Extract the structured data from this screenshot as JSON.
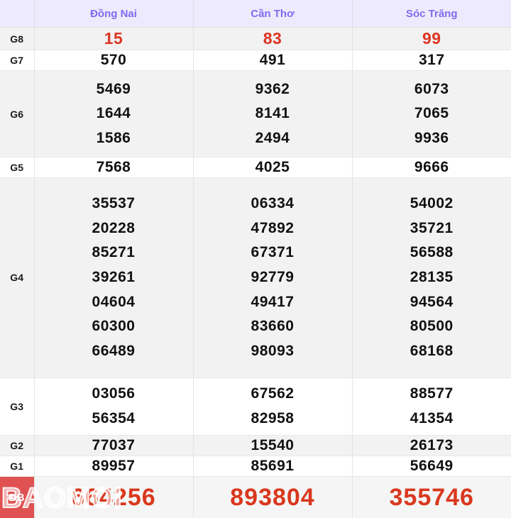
{
  "table": {
    "corner_label": "",
    "columns": [
      "Đồng Nai",
      "Cần Thơ",
      "Sóc Trăng"
    ],
    "colors": {
      "header_bg": "#eeeafd",
      "header_text": "#7d6cf0",
      "row_gray_bg": "#f2f2f2",
      "row_white_bg": "#ffffff",
      "prize_red": "#dc3522",
      "special_red": "#d9381e",
      "badge_bg": "#e05252",
      "border": "#e4e4e4"
    },
    "rows": [
      {
        "label": "G8",
        "style": "gray",
        "red": true,
        "values": [
          [
            "15"
          ],
          [
            "83"
          ],
          [
            "99"
          ]
        ]
      },
      {
        "label": "G7",
        "style": "white",
        "red": false,
        "values": [
          [
            "570"
          ],
          [
            "491"
          ],
          [
            "317"
          ]
        ]
      },
      {
        "label": "G6",
        "style": "gray",
        "red": false,
        "values": [
          [
            "5469",
            "1644",
            "1586"
          ],
          [
            "9362",
            "8141",
            "2494"
          ],
          [
            "6073",
            "7065",
            "9936"
          ]
        ]
      },
      {
        "label": "G5",
        "style": "white",
        "red": false,
        "values": [
          [
            "7568"
          ],
          [
            "4025"
          ],
          [
            "9666"
          ]
        ]
      },
      {
        "label": "G4",
        "style": "gray",
        "red": false,
        "values": [
          [
            "35537",
            "20228",
            "85271",
            "39261",
            "04604",
            "60300",
            "66489"
          ],
          [
            "06334",
            "47892",
            "67371",
            "92779",
            "49417",
            "83660",
            "98093"
          ],
          [
            "54002",
            "35721",
            "56588",
            "28135",
            "94564",
            "80500",
            "68168"
          ]
        ]
      },
      {
        "label": "G3",
        "style": "white",
        "red": false,
        "values": [
          [
            "03056",
            "56354"
          ],
          [
            "67562",
            "82958"
          ],
          [
            "88577",
            "41354"
          ]
        ]
      },
      {
        "label": "G2",
        "style": "gray",
        "red": false,
        "values": [
          [
            "77037"
          ],
          [
            "15540"
          ],
          [
            "26173"
          ]
        ]
      },
      {
        "label": "G1",
        "style": "white",
        "red": false,
        "values": [
          [
            "89957"
          ],
          [
            "85691"
          ],
          [
            "56649"
          ]
        ]
      }
    ],
    "special_row": {
      "label": "ĐB",
      "values": [
        "664256",
        "893804",
        "355746"
      ]
    },
    "watermark": {
      "text": "BAOMOI"
    }
  }
}
